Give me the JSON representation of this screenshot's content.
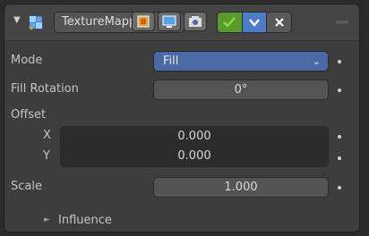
{
  "header": {
    "modifier_name": "TextureMappi...",
    "collapse_arrow": "▼",
    "icons": {
      "modifier": "uv-texture-icon",
      "editmode": "editmode-cage-icon",
      "viewport": "viewport-display-icon",
      "render": "render-camera-icon",
      "apply": "apply-check-icon",
      "menu": "dropdown-chevron-icon",
      "remove": "close-icon",
      "drag": "drag-handle-icon"
    }
  },
  "rows": {
    "mode_label": "Mode",
    "mode_value": "Fill",
    "fill_rotation_label": "Fill Rotation",
    "fill_rotation_value": "0°",
    "offset_label": "Offset",
    "x_label": "X",
    "x_value": "0.000",
    "y_label": "Y",
    "y_value": "0.000",
    "scale_label": "Scale",
    "scale_value": "1.000"
  },
  "influence": {
    "label": "Influence",
    "arrow": "►"
  },
  "colors": {
    "accent": "#4a6aa5",
    "apply_green": "#5b9a2e",
    "panel": "#3d3d3d",
    "background": "#2b2b2b"
  }
}
